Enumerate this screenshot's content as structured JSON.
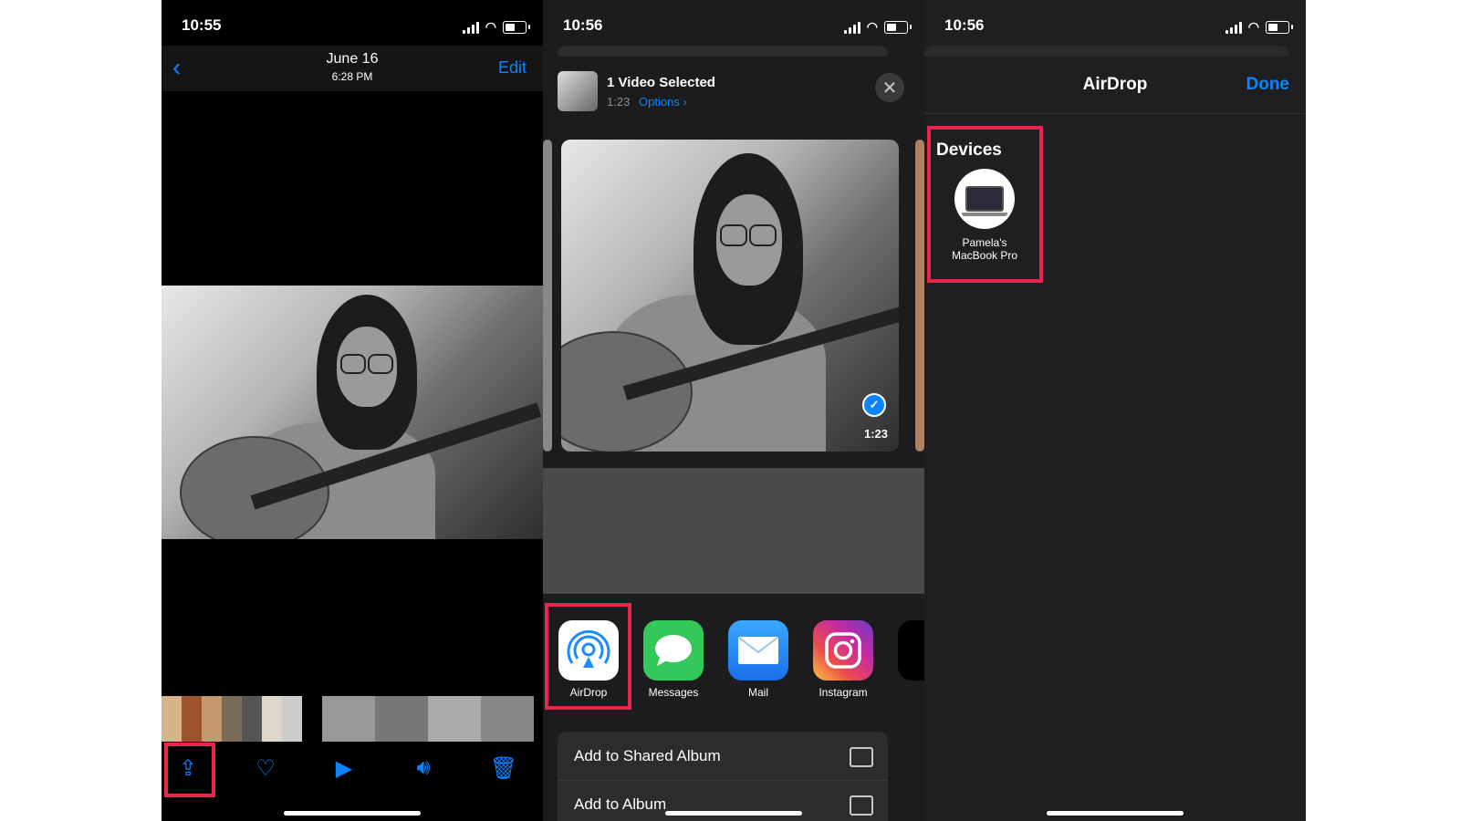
{
  "panel1": {
    "status_time": "10:55",
    "date": "June 16",
    "time": "6:28 PM",
    "edit_label": "Edit",
    "icons": [
      "back-chevron-icon",
      "share-icon",
      "heart-icon",
      "play-icon",
      "speaker-icon",
      "trash-icon"
    ]
  },
  "panel2": {
    "status_time": "10:56",
    "selected_label": "1 Video Selected",
    "duration": "1:23",
    "options_label": "Options",
    "video_duration": "1:23",
    "apps": [
      {
        "label": "AirDrop",
        "color": "#ffffff"
      },
      {
        "label": "Messages",
        "color": "#34c759"
      },
      {
        "label": "Mail",
        "color": "#1a8cff"
      },
      {
        "label": "Instagram",
        "color": "#d6249f"
      }
    ],
    "actions": [
      {
        "label": "Add to Shared Album"
      },
      {
        "label": "Add to Album"
      }
    ]
  },
  "panel3": {
    "status_time": "10:56",
    "title": "AirDrop",
    "done_label": "Done",
    "devices_heading": "Devices",
    "device_name": "Pamela's MacBook Pro"
  },
  "highlight_color": "#e8254a",
  "accent_color": "#0a84ff"
}
